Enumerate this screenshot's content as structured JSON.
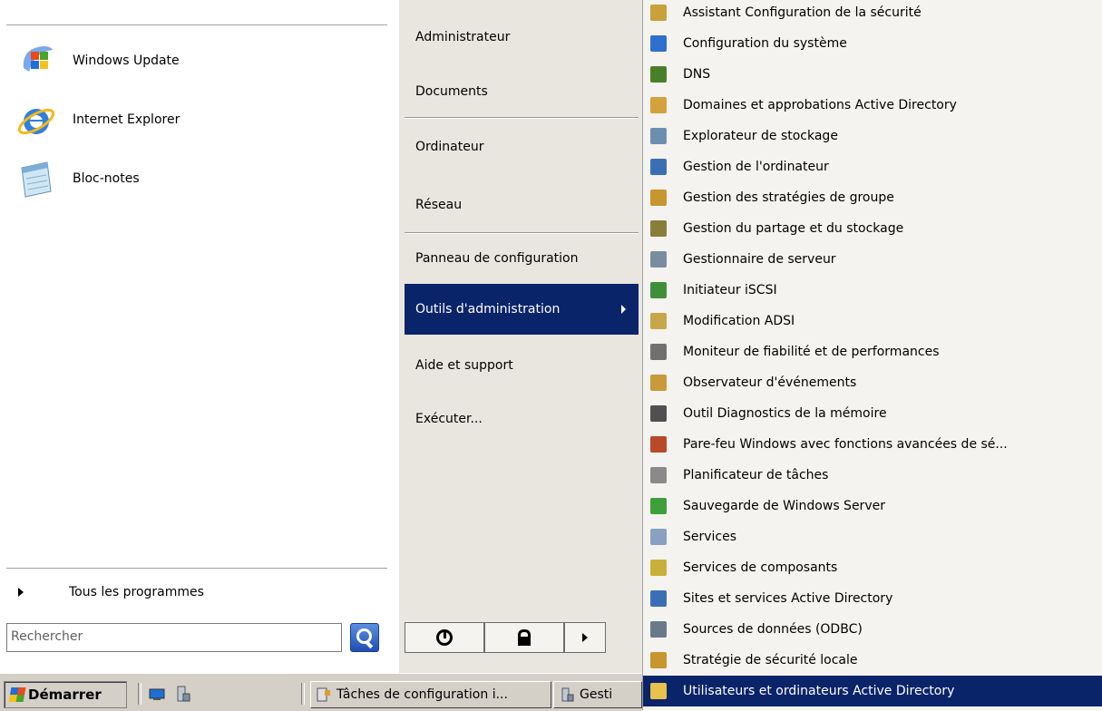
{
  "left_pane": {
    "pinned": [
      {
        "label": "Windows Update",
        "icon": "windows-update-icon"
      },
      {
        "label": "Internet Explorer",
        "icon": "internet-explorer-icon"
      },
      {
        "label": "Bloc-notes",
        "icon": "notepad-icon"
      }
    ],
    "all_programs_label": "Tous les programmes",
    "search": {
      "placeholder": "Rechercher",
      "value": ""
    }
  },
  "middle_pane": {
    "items": [
      {
        "label": "Administrateur"
      },
      {
        "label": "Documents"
      },
      {
        "label": "Ordinateur"
      },
      {
        "label": "Réseau"
      },
      {
        "label": "Panneau de configuration"
      },
      {
        "label": "Outils d'administration",
        "selected": true
      },
      {
        "label": "Aide et support"
      },
      {
        "label": "Exécuter..."
      }
    ]
  },
  "admin_tools": {
    "items": [
      {
        "label": "Assistant Configuration de la sécurité",
        "icon": "security-wizard-icon",
        "color": "#c9a13a"
      },
      {
        "label": "Configuration du système",
        "icon": "msconfig-icon",
        "color": "#2f6fce"
      },
      {
        "label": "DNS",
        "icon": "dns-icon",
        "color": "#4a7f2a"
      },
      {
        "label": "Domaines et approbations Active Directory",
        "icon": "ad-domains-icon",
        "color": "#d4a23a"
      },
      {
        "label": "Explorateur de stockage",
        "icon": "storage-explorer-icon",
        "color": "#6c8fb0"
      },
      {
        "label": "Gestion de l'ordinateur",
        "icon": "computer-management-icon",
        "color": "#3a6fb5"
      },
      {
        "label": "Gestion des stratégies de groupe",
        "icon": "gpo-icon",
        "color": "#c8962e"
      },
      {
        "label": "Gestion du partage et du stockage",
        "icon": "share-storage-icon",
        "color": "#8a7d3a"
      },
      {
        "label": "Gestionnaire de serveur",
        "icon": "server-manager-icon",
        "color": "#7a8da0"
      },
      {
        "label": "Initiateur iSCSI",
        "icon": "iscsi-icon",
        "color": "#3f8f3a"
      },
      {
        "label": "Modification ADSI",
        "icon": "adsi-edit-icon",
        "color": "#c8a64a"
      },
      {
        "label": "Moniteur de fiabilité et de performances",
        "icon": "perf-monitor-icon",
        "color": "#707070"
      },
      {
        "label": "Observateur d'événements",
        "icon": "event-viewer-icon",
        "color": "#c89a3a"
      },
      {
        "label": "Outil Diagnostics de la mémoire",
        "icon": "memory-diag-icon",
        "color": "#505050"
      },
      {
        "label": "Pare-feu Windows avec fonctions avancées de sé...",
        "icon": "firewall-icon",
        "color": "#b84a2a"
      },
      {
        "label": "Planificateur de tâches",
        "icon": "task-scheduler-icon",
        "color": "#8a8a8a"
      },
      {
        "label": "Sauvegarde de Windows Server",
        "icon": "backup-icon",
        "color": "#3f9f3a"
      },
      {
        "label": "Services",
        "icon": "services-icon",
        "color": "#8aa0c0"
      },
      {
        "label": "Services de composants",
        "icon": "component-services-icon",
        "color": "#c8b03a"
      },
      {
        "label": "Sites et services Active Directory",
        "icon": "ad-sites-icon",
        "color": "#3a6fb5"
      },
      {
        "label": "Sources de données (ODBC)",
        "icon": "odbc-icon",
        "color": "#6a7a8a"
      },
      {
        "label": "Stratégie de sécurité locale",
        "icon": "local-security-policy-icon",
        "color": "#c8962e"
      },
      {
        "label": "Utilisateurs et ordinateurs Active Directory",
        "icon": "ad-users-icon",
        "color": "#e8c24a",
        "selected": true
      }
    ]
  },
  "taskbar": {
    "start_label": "Démarrer",
    "buttons": [
      {
        "label": "Tâches de configuration i...",
        "icon": "config-tasks-icon"
      },
      {
        "label": "Gesti",
        "icon": "server-manager-icon"
      }
    ]
  },
  "colors": {
    "selection": "#0a246a",
    "menu_bg": "#f4f3ef",
    "places_bg": "#e9e6e0"
  }
}
